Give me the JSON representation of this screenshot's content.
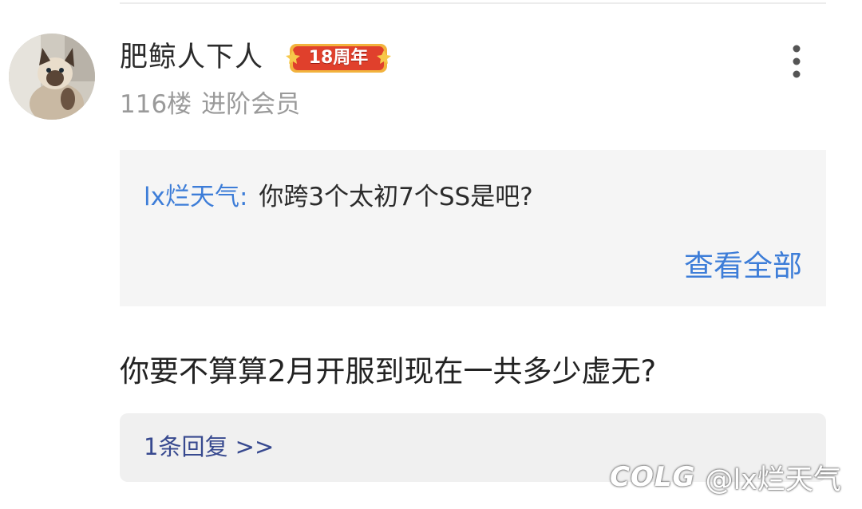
{
  "comment": {
    "author": "肥鲸人下人",
    "badge": "18周年",
    "floor": "116楼",
    "member_level": "进阶会员",
    "quote": {
      "author": "lx烂天气:",
      "text": "你跨3个太初7个SS是吧?",
      "view_all_label": "查看全部"
    },
    "content": "你要不算算2月开服到现在一共多少虚无?",
    "replies_label": "1条回复 >>"
  },
  "watermark": {
    "logo": "COLG",
    "handle": "@lx烂天气"
  },
  "icons": {
    "avatar": "cat-avatar-icon",
    "more": "more-vertical-icon"
  },
  "colors": {
    "link_blue": "#3d7dd8",
    "reply_blue": "#37498f",
    "badge_red": "#e0402c",
    "badge_gold": "#f2b33d"
  }
}
